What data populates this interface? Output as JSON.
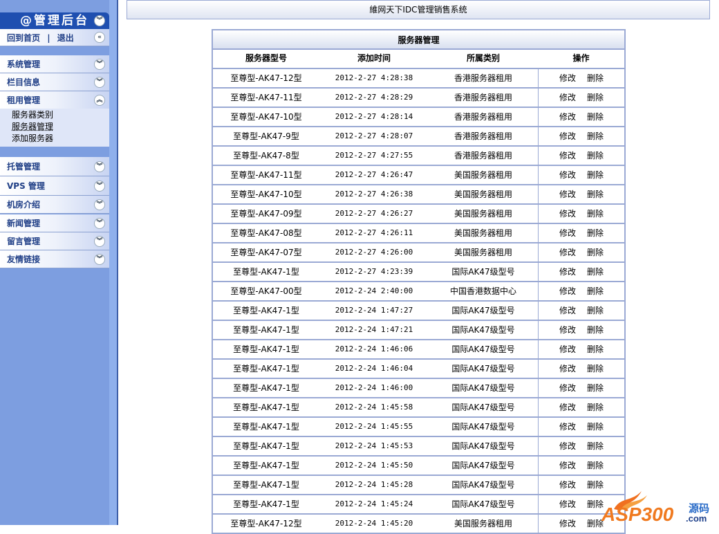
{
  "sidebar": {
    "title": "@管理后台",
    "home": "回到首页",
    "exit": "退出",
    "sep": "|",
    "menus_a": [
      "系统管理",
      "栏目信息",
      "租用管理"
    ],
    "submenu": [
      "服务器类别",
      "服务器管理",
      "添加服务器"
    ],
    "menus_b": [
      "托管管理",
      "VPS 管理",
      "机房介绍",
      "新闻管理",
      "留言管理",
      "友情链接"
    ]
  },
  "header": {
    "title": "維网天下IDC管理销售系统"
  },
  "table": {
    "caption": "服务器管理",
    "columns": [
      "服务器型号",
      "添加时间",
      "所属类别",
      "操作"
    ],
    "edit": "修改",
    "delete": "删除",
    "rows": [
      [
        "至尊型-AK47-12型",
        "2012-2-27 4:28:38",
        "香港服务器租用"
      ],
      [
        "至尊型-AK47-11型",
        "2012-2-27 4:28:29",
        "香港服务器租用"
      ],
      [
        "至尊型-AK47-10型",
        "2012-2-27 4:28:14",
        "香港服务器租用"
      ],
      [
        "至尊型-AK47-9型",
        "2012-2-27 4:28:07",
        "香港服务器租用"
      ],
      [
        "至尊型-AK47-8型",
        "2012-2-27 4:27:55",
        "香港服务器租用"
      ],
      [
        "至尊型-AK47-11型",
        "2012-2-27 4:26:47",
        "美国服务器租用"
      ],
      [
        "至尊型-AK47-10型",
        "2012-2-27 4:26:38",
        "美国服务器租用"
      ],
      [
        "至尊型-AK47-09型",
        "2012-2-27 4:26:27",
        "美国服务器租用"
      ],
      [
        "至尊型-AK47-08型",
        "2012-2-27 4:26:11",
        "美国服务器租用"
      ],
      [
        "至尊型-AK47-07型",
        "2012-2-27 4:26:00",
        "美国服务器租用"
      ],
      [
        "至尊型-AK47-1型",
        "2012-2-27 4:23:39",
        "国际AK47级型号"
      ],
      [
        "至尊型-AK47-00型",
        "2012-2-24 2:40:00",
        "中国香港数据中心"
      ],
      [
        "至尊型-AK47-1型",
        "2012-2-24 1:47:27",
        "国际AK47级型号"
      ],
      [
        "至尊型-AK47-1型",
        "2012-2-24 1:47:21",
        "国际AK47级型号"
      ],
      [
        "至尊型-AK47-1型",
        "2012-2-24 1:46:06",
        "国际AK47级型号"
      ],
      [
        "至尊型-AK47-1型",
        "2012-2-24 1:46:04",
        "国际AK47级型号"
      ],
      [
        "至尊型-AK47-1型",
        "2012-2-24 1:46:00",
        "国际AK47级型号"
      ],
      [
        "至尊型-AK47-1型",
        "2012-2-24 1:45:58",
        "国际AK47级型号"
      ],
      [
        "至尊型-AK47-1型",
        "2012-2-24 1:45:55",
        "国际AK47级型号"
      ],
      [
        "至尊型-AK47-1型",
        "2012-2-24 1:45:53",
        "国际AK47级型号"
      ],
      [
        "至尊型-AK47-1型",
        "2012-2-24 1:45:50",
        "国际AK47级型号"
      ],
      [
        "至尊型-AK47-1型",
        "2012-2-24 1:45:28",
        "国际AK47级型号"
      ],
      [
        "至尊型-AK47-1型",
        "2012-2-24 1:45:24",
        "国际AK47级型号"
      ],
      [
        "至尊型-AK47-12型",
        "2012-2-24 1:45:20",
        "美国服务器租用"
      ]
    ]
  },
  "watermark": {
    "text": "ASP300源码.com"
  }
}
